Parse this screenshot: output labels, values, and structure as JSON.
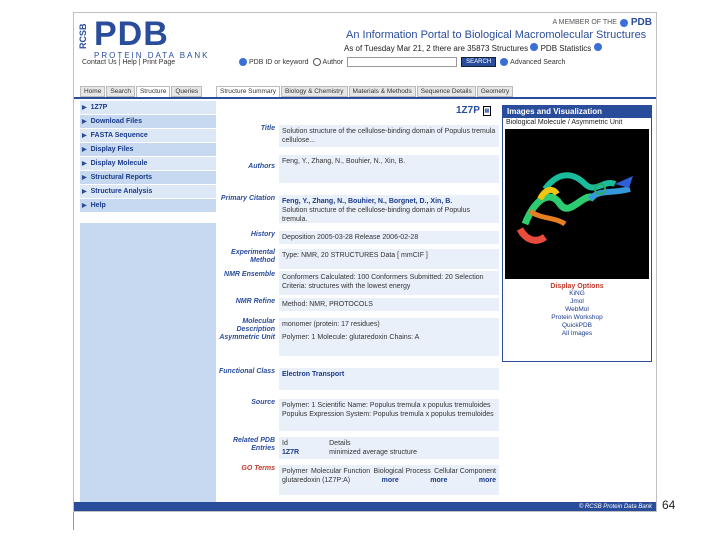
{
  "header": {
    "rcsb": "RCSB",
    "logo": "PDB",
    "logo_sub": "PROTEIN DATA BANK",
    "member_text": "A MEMBER OF THE",
    "member_logo": "PDB",
    "tagline": "An Information Portal to Biological Macromolecular Structures",
    "asof": "As of Tuesday Mar 21, 2 there are 35873 Structures",
    "stats": "PDB Statistics"
  },
  "topnav": "Contact Us | Help | Print Page",
  "search": {
    "pdb_id": "PDB ID or keyword",
    "author": "Author",
    "button": "SEARCH",
    "advanced": "Advanced Search"
  },
  "tabs": [
    "Home",
    "Search",
    "Structure",
    "Queries"
  ],
  "subtabs": [
    "Structure Summary",
    "Biology & Chemistry",
    "Materials & Methods",
    "Sequence Details",
    "Geometry"
  ],
  "sidebar": {
    "items": [
      "1Z7P",
      "Download Files",
      "FASTA Sequence",
      "Display Files",
      "Display Molecule",
      "Structural Reports",
      "Structure Analysis",
      "Help"
    ]
  },
  "pdb_id": "1Z7P",
  "fields": {
    "title_label": "Title",
    "title_val": "Solution structure of the cellulose-binding domain of Populus tremula cellulose...",
    "authors_label": "Authors",
    "authors_val": "Feng, Y., Zhang, N., Bouhier, N., Xin, B.",
    "primary_label": "Primary Citation",
    "primary_authors": "Feng, Y., Zhang, N., Bouhier, N., Borgnet, D., Xin, B.",
    "primary_val": "Solution structure of the cellulose-binding domain of Populus tremula.",
    "history_label": "History",
    "history_val": "Deposition 2005-03-28  Release 2006-02-28",
    "exp_label": "Experimental Method",
    "exp_val": "Type: NMR, 20 STRUCTURES  Data  [ mmCIF ]",
    "nmr_label": "NMR Ensemble",
    "nmr_val": "Conformers Calculated: 100   Conformers Submitted: 20   Selection Criteria: structures with the lowest energy",
    "nmrref_label": "NMR Refine",
    "nmrref_val": "Method: NMR, PROTOCOLS",
    "mol_label": "Molecular Description Asymmetric Unit",
    "mol_val1": "monomer (protein: 17 residues)",
    "mol_val2": "Polymer: 1   Molecule: glutaredoxin   Chains: A",
    "func_label": "Functional Class",
    "func_val": "Electron Transport",
    "source_label": "Source",
    "source_val1": "Polymer: 1   Scientific Name: Populus tremula x populus tremuloides",
    "source_val2": "Populus   Expression System: Populus tremula x populus tremuloides",
    "source_common": "Common Name",
    "related_label": "Related PDB Entries",
    "related_id_hdr": "Id",
    "related_detail_hdr": "Details",
    "related_id": "1Z7R",
    "related_detail": "minimized average structure",
    "go_label": "GO Terms",
    "go_polymer": "Polymer",
    "go_mol_func": "Molecular Function",
    "go_bio_proc": "Biological Process",
    "go_cell_comp": "Cellular Component",
    "go_val": "glutaredoxin (1Z7P:A)",
    "go_more1": "more",
    "go_more2": "more",
    "go_more3": "more"
  },
  "images": {
    "header": "Images and Visualization",
    "caption": "Biological Molecule / Asymmetric Unit",
    "display_options": "Display Options",
    "options": [
      "KiNG",
      "Jmol",
      "WebMol",
      "Protein Workshop",
      "QuickPDB",
      "All Images"
    ]
  },
  "footer": "© RCSB Protein Data Bank",
  "page_number": "64"
}
